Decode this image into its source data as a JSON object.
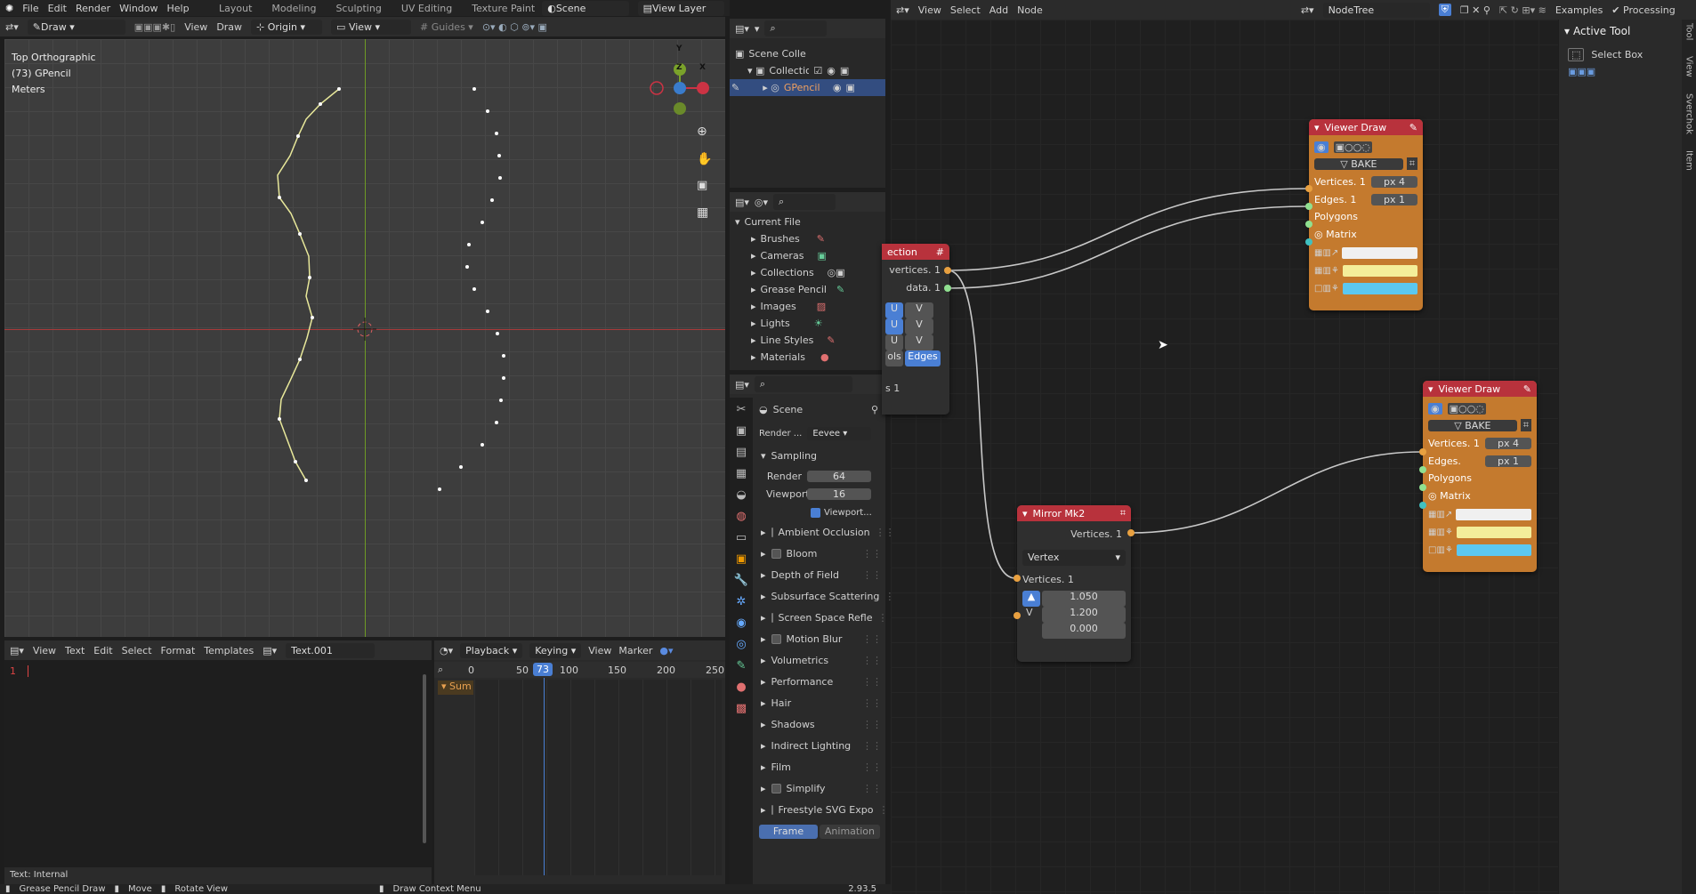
{
  "topbar": {
    "menus": [
      "File",
      "Edit",
      "Render",
      "Window",
      "Help"
    ],
    "workspaces": [
      "Layout",
      "Modeling",
      "Sculpting",
      "UV Editing",
      "Texture Paint"
    ],
    "scene": "Scene",
    "view_layer": "View Layer"
  },
  "viewport": {
    "mode": "Draw",
    "menus": [
      "View",
      "Draw"
    ],
    "origin": "Origin",
    "view_select": "View",
    "guides": "Guides",
    "overlay_lines": [
      "Top Orthographic",
      "(73) GPencil",
      "Meters"
    ],
    "gizmo_labels": {
      "y": "Y",
      "z": "Z",
      "x": "X"
    },
    "colors": {
      "bg": "#3d3d3d",
      "x_axis": "#a83a3a",
      "y_axis": "#7aa22a",
      "stroke": "#e8e89a"
    }
  },
  "outliner": {
    "rows": [
      {
        "label": "Scene Collection"
      },
      {
        "label": "Collection"
      },
      {
        "label": "GPencil"
      }
    ]
  },
  "file_browser": {
    "root": "Current File",
    "items": [
      "Brushes",
      "Cameras",
      "Collections",
      "Grease Pencil",
      "Images",
      "Lights",
      "Line Styles",
      "Materials"
    ]
  },
  "properties": {
    "context": "Scene",
    "render_label": "Render ...",
    "render_engine": "Eevee",
    "sampling": {
      "title": "Sampling",
      "render_label": "Render",
      "render_value": "64",
      "viewport_label": "Viewport",
      "viewport_value": "16",
      "denoise_label": "Viewport..."
    },
    "panels": [
      {
        "label": "Ambient Occlusion",
        "checkbox": true
      },
      {
        "label": "Bloom",
        "checkbox": true
      },
      {
        "label": "Depth of Field",
        "checkbox": false
      },
      {
        "label": "Subsurface Scattering",
        "checkbox": false
      },
      {
        "label": "Screen Space Refle",
        "checkbox": true
      },
      {
        "label": "Motion Blur",
        "checkbox": true
      },
      {
        "label": "Volumetrics",
        "checkbox": false
      },
      {
        "label": "Performance",
        "checkbox": false
      },
      {
        "label": "Hair",
        "checkbox": false
      },
      {
        "label": "Shadows",
        "checkbox": false
      },
      {
        "label": "Indirect Lighting",
        "checkbox": false
      },
      {
        "label": "Film",
        "checkbox": false
      },
      {
        "label": "Simplify",
        "checkbox": true
      },
      {
        "label": "Freestyle SVG Expo",
        "checkbox": true
      }
    ],
    "footer_tabs": [
      "Frame",
      "Animation"
    ]
  },
  "text_editor": {
    "menus": [
      "View",
      "Text",
      "Edit",
      "Select",
      "Format",
      "Templates"
    ],
    "filename": "Text.001",
    "line_number": "1",
    "footer": "Text: Internal"
  },
  "timeline": {
    "menus": [
      "Playback",
      "Keying",
      "View",
      "Marker"
    ],
    "ticks": [
      "0",
      "50",
      "100",
      "150",
      "200",
      "250"
    ],
    "current_frame": "73",
    "summary": "Sum"
  },
  "node_editor": {
    "menus": [
      "View",
      "Select",
      "Add",
      "Node"
    ],
    "tree_name": "NodeTree",
    "right_items": [
      "Examples",
      "Processing"
    ],
    "partial_node": {
      "title": "ection",
      "outputs": [
        "vertices. 1",
        "data. 1"
      ],
      "rows": [
        [
          "U",
          "V"
        ],
        [
          "U",
          "V"
        ],
        [
          "U",
          "V"
        ]
      ],
      "bottom_left": "ols",
      "bottom_right": "Edges",
      "footer": "s 1"
    },
    "viewer1": {
      "title": "Viewer Draw",
      "bake": "BAKE",
      "inputs": [
        {
          "label": "Vertices. 1",
          "unit": "px",
          "value": "4"
        },
        {
          "label": "Edges. 1",
          "unit": "px",
          "value": "1"
        },
        {
          "label": "Polygons"
        },
        {
          "label": "Matrix"
        }
      ],
      "colors": [
        "#f0f0f0",
        "#f4ee9a",
        "#5cc8f0"
      ]
    },
    "viewer2": {
      "title": "Viewer Draw",
      "bake": "BAKE",
      "inputs": [
        {
          "label": "Vertices. 1",
          "unit": "px",
          "value": "4"
        },
        {
          "label": "Edges.",
          "unit": "px",
          "value": "1"
        },
        {
          "label": "Polygons"
        },
        {
          "label": "Matrix"
        }
      ],
      "colors": [
        "#f0f0f0",
        "#f4ee9a",
        "#5cc8f0"
      ]
    },
    "mirror": {
      "title": "Mirror Mk2",
      "output": "Vertices. 1",
      "mode": "Vertex",
      "input": "Vertices. 1",
      "values": [
        "1.050",
        "1.200",
        "0.000"
      ],
      "v_label": "V"
    }
  },
  "sidebar": {
    "panel": "Active Tool",
    "tool": "Select Box",
    "tabs": [
      "Tool",
      "View",
      "Sverchok",
      "Item"
    ]
  },
  "statusbar": {
    "items": [
      "Grease Pencil Draw",
      "Move",
      "Rotate View",
      "Draw Context Menu"
    ],
    "version": "2.93.5"
  }
}
